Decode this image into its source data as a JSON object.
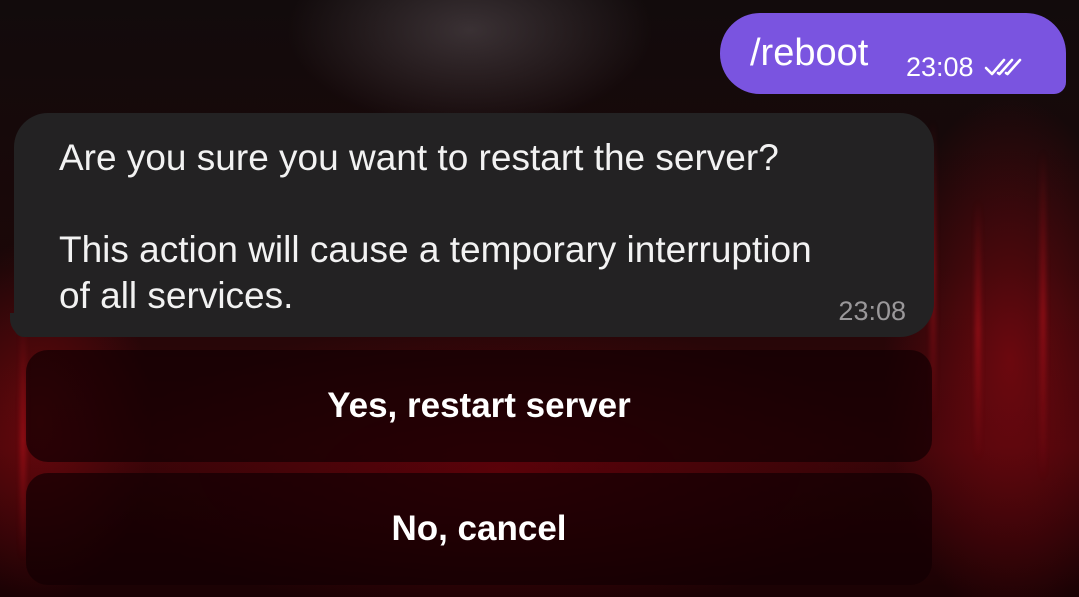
{
  "chat": {
    "outgoing": {
      "text": "/reboot",
      "time": "23:08",
      "status_icon": "double-check-icon"
    },
    "incoming": {
      "line1": "Are you sure you want to restart the server?",
      "line2": "This action will cause a temporary interruption",
      "line3": "of all services.",
      "time": "23:08"
    }
  },
  "keyboard": {
    "buttons": [
      {
        "label": "Yes, restart server"
      },
      {
        "label": "No, cancel"
      }
    ]
  },
  "colors": {
    "outgoing_bubble": "#7a54e0",
    "incoming_bubble": "#232223",
    "button_bg": "#140003"
  }
}
